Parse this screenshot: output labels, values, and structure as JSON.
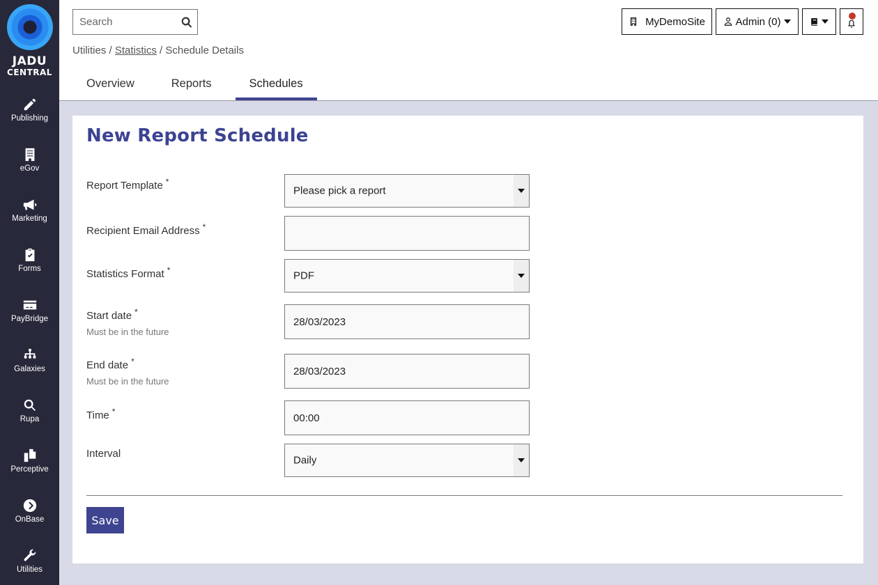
{
  "brand": {
    "line1": "JADU",
    "line2": "CENTRAL"
  },
  "sidebar": {
    "items": [
      {
        "label": "Publishing",
        "icon": "pencil-icon"
      },
      {
        "label": "eGov",
        "icon": "building-icon"
      },
      {
        "label": "Marketing",
        "icon": "megaphone-icon"
      },
      {
        "label": "Forms",
        "icon": "clipboard-check-icon"
      },
      {
        "label": "PayBridge",
        "icon": "credit-card-icon"
      },
      {
        "label": "Galaxies",
        "icon": "sitemap-icon"
      },
      {
        "label": "Rupa",
        "icon": "search-icon"
      },
      {
        "label": "Perceptive",
        "icon": "copy-icon"
      },
      {
        "label": "OnBase",
        "icon": "chevron-circle-right-icon"
      },
      {
        "label": "Utilities",
        "icon": "wrench-icon"
      }
    ]
  },
  "header": {
    "search_placeholder": "Search",
    "site_label": "MyDemoSite",
    "admin_label": "Admin (0)",
    "breadcrumb": {
      "first": "Utilities",
      "second": "Statistics",
      "third": "Schedule Details",
      "sep": "/"
    },
    "tabs": [
      {
        "label": "Overview",
        "active": false
      },
      {
        "label": "Reports",
        "active": false
      },
      {
        "label": "Schedules",
        "active": true
      }
    ]
  },
  "form": {
    "title": "New Report Schedule",
    "required_mark": "*",
    "fields": [
      {
        "label": "Report Template",
        "required": true,
        "type": "select",
        "value": "Please pick a report"
      },
      {
        "label": "Recipient Email Address",
        "required": true,
        "type": "text",
        "value": ""
      },
      {
        "label": "Statistics Format",
        "required": true,
        "type": "select",
        "value": "PDF"
      },
      {
        "label": "Start date",
        "required": true,
        "hint": "Must be in the future",
        "type": "text",
        "value": "28/03/2023"
      },
      {
        "label": "End date",
        "required": true,
        "hint": "Must be in the future",
        "type": "text",
        "value": "28/03/2023"
      },
      {
        "label": "Time",
        "required": true,
        "type": "text",
        "value": "00:00"
      },
      {
        "label": "Interval",
        "required": false,
        "type": "select",
        "value": "Daily"
      }
    ],
    "save_label": "Save"
  },
  "colors": {
    "accent": "#3f4490",
    "sidebar": "#27283a",
    "page_bg": "#d9dae7",
    "notification_dot": "#c0392b"
  }
}
